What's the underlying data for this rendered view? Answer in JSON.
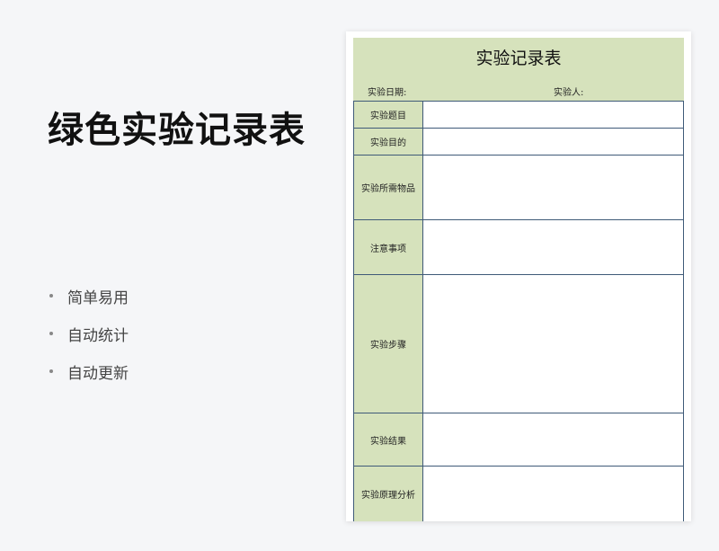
{
  "promo": {
    "title": "绿色实验记录表",
    "features": [
      "简单易用",
      "自动统计",
      "自动更新"
    ]
  },
  "sheet": {
    "title": "实验记录表",
    "date_label": "实验日期:",
    "person_label": "实验人:",
    "rows": [
      {
        "label": "实验题目",
        "value": ""
      },
      {
        "label": "实验目的",
        "value": ""
      },
      {
        "label": "实验所需物品",
        "value": ""
      },
      {
        "label": "注意事项",
        "value": ""
      },
      {
        "label": "实验步骤",
        "value": ""
      },
      {
        "label": "实验结果",
        "value": ""
      },
      {
        "label": "实验原理分析",
        "value": ""
      }
    ]
  },
  "colors": {
    "header_green": "#d6e2bc",
    "border_blue": "#3f5a78",
    "background": "#f5f6f8"
  }
}
